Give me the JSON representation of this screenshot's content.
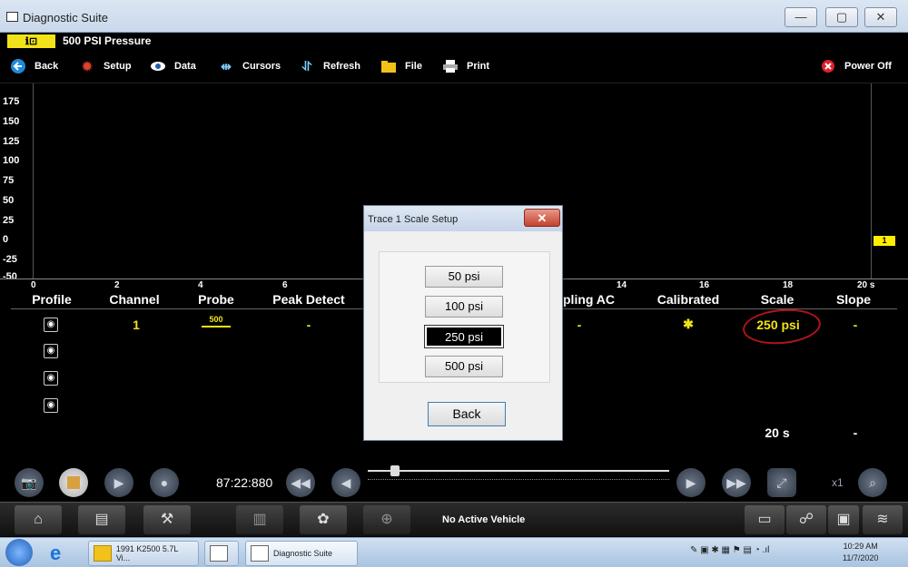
{
  "window": {
    "title": "Diagnostic Suite",
    "minimize": "—",
    "maximize": "▢",
    "close": "✕"
  },
  "header": {
    "logo": "ℹ⊡",
    "title": "500 PSI Pressure"
  },
  "toolbar": {
    "back": "Back",
    "setup": "Setup",
    "data": "Data",
    "cursors": "Cursors",
    "refresh": "Refresh",
    "file": "File",
    "print": "Print",
    "power_off": "Power Off"
  },
  "graph": {
    "y_ticks": [
      "175",
      "150",
      "125",
      "100",
      "75",
      "50",
      "25",
      "0",
      "-25",
      "-50"
    ],
    "x_ticks": [
      "0",
      "2",
      "4",
      "6",
      "14",
      "16",
      "18",
      "20 s"
    ],
    "trace_marker": "1"
  },
  "table": {
    "columns": [
      "Profile",
      "Channel",
      "Probe",
      "Peak Detect",
      "pling AC",
      "Calibrated",
      "Scale",
      "Slope"
    ],
    "row1": {
      "channel": "1",
      "probe": "500",
      "peak_detect": "-",
      "coupling_ac": "-",
      "calibrated": "✱",
      "scale": "250 psi",
      "slope": "-"
    },
    "row_time": {
      "scale": "20 s",
      "slope": "-"
    }
  },
  "playback": {
    "time": "87:22:880",
    "zoom": "x1"
  },
  "appbar": {
    "status": "No Active Vehicle"
  },
  "taskbar": {
    "item1": "1991 K2500 5.7L Vi...",
    "item2": "Diagnostic Suite",
    "time": "10:29 AM",
    "date": "11/7/2020"
  },
  "dialog": {
    "title": "Trace 1 Scale Setup",
    "options": [
      "50 psi",
      "100 psi",
      "250 psi",
      "500 psi"
    ],
    "selected": "250 psi",
    "back": "Back"
  },
  "colors": {
    "accent_yellow": "#f2e21a",
    "circle_red": "#b0141c"
  }
}
